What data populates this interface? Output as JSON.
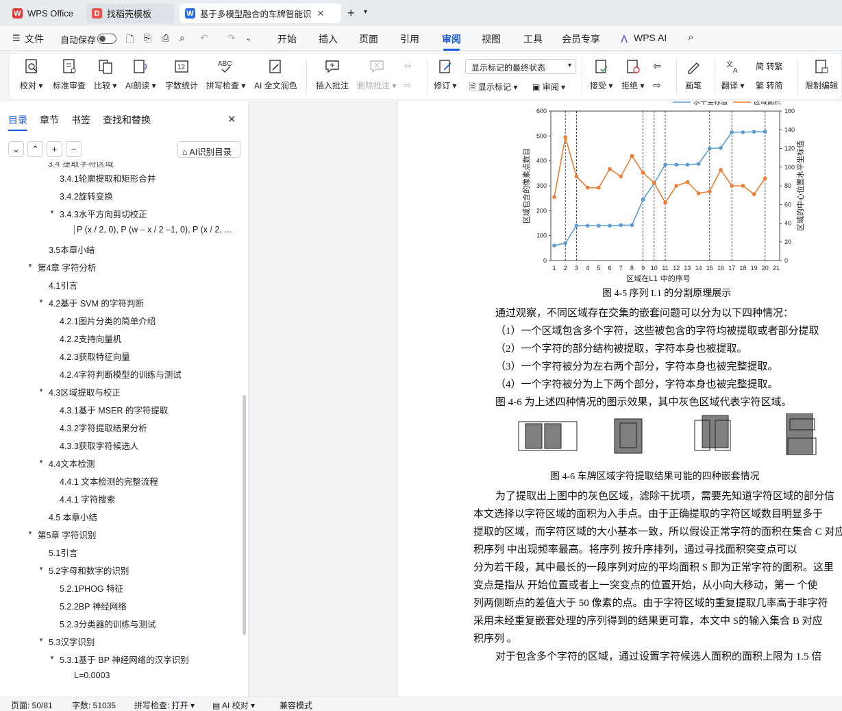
{
  "tabs": {
    "wps_office": "WPS Office",
    "template": "找稻壳模板",
    "document": "基于多模型融合的车牌智能识"
  },
  "menu": {
    "file": "文件",
    "autosave": "自动保存",
    "items": [
      "开始",
      "插入",
      "页面",
      "引用",
      "审阅",
      "视图",
      "工具",
      "会员专享"
    ],
    "ai": "WPS AI"
  },
  "ribbon": {
    "proofread": "校对",
    "standard_review": "标准审查",
    "compare": "比较",
    "ai_read": "AI朗读",
    "word_count": "字数统计",
    "spell_check": "拼写检查",
    "ai_polish": "AI 全文润色",
    "insert_comment": "插入批注",
    "delete_comment": "删除批注",
    "track": "修订",
    "markup_mode": "显示标记的最终状态",
    "show_markup": "显示标记",
    "review": "审阅",
    "accept": "接受",
    "reject": "拒绝",
    "ink": "画笔",
    "translate": "翻译",
    "to_traditional": "转繁",
    "to_simplified": "转简",
    "restrict_edit": "限制编辑"
  },
  "sidebar": {
    "tabs": [
      "目录",
      "章节",
      "书签",
      "查找和替换"
    ],
    "ai_toc": "AI识别目录",
    "toc": [
      {
        "t": "3.4.1轮廓提取和矩形合并",
        "l": 3
      },
      {
        "t": "3.4.2旋转变换",
        "l": 3
      },
      {
        "t": "3.4.3水平方向剪切校正",
        "l": 3,
        "exp": true
      },
      {
        "t": "P (x / 2, 0), P (w – x / 2 –1, 0), P (x / 2, ...",
        "l": 4
      },
      {
        "t": "3.5本章小结",
        "l": 2
      },
      {
        "t": "第4章 字符分析",
        "l": 1,
        "exp": true
      },
      {
        "t": "4.1引言",
        "l": 2
      },
      {
        "t": "4.2基于 SVM 的字符判断",
        "l": 2,
        "exp": true
      },
      {
        "t": "4.2.1图片分类的简单介绍",
        "l": 3
      },
      {
        "t": "4.2.2支持向量机",
        "l": 3
      },
      {
        "t": "4.2.3获取特征向量",
        "l": 3
      },
      {
        "t": "4.2.4字符判断模型的训练与测试",
        "l": 3
      },
      {
        "t": "4.3区域提取与校正",
        "l": 2,
        "exp": true
      },
      {
        "t": "4.3.1基于 MSER 的字符提取",
        "l": 3
      },
      {
        "t": "4.3.2字符提取结果分析",
        "l": 3
      },
      {
        "t": "4.3.3获取字符候选人",
        "l": 3
      },
      {
        "t": "4.4文本检测",
        "l": 2,
        "exp": true
      },
      {
        "t": "4.4.1 文本检测的完整流程",
        "l": 3
      },
      {
        "t": "4.4.1 字符搜索",
        "l": 3
      },
      {
        "t": "4.5 本章小结",
        "l": 2
      },
      {
        "t": "第5章 字符识别",
        "l": 1,
        "exp": true
      },
      {
        "t": "5.1引言",
        "l": 2
      },
      {
        "t": "5.2字母和数字的识别",
        "l": 2,
        "exp": true
      },
      {
        "t": "5.2.1PHOG 特征",
        "l": 3
      },
      {
        "t": "5.2.2BP 神经网络",
        "l": 3
      },
      {
        "t": "5.2.3分类器的训练与测试",
        "l": 3
      },
      {
        "t": "5.3汉字识别",
        "l": 2,
        "exp": true
      },
      {
        "t": "5.3.1基于 BP 神经网络的汉字识别",
        "l": 3,
        "exp": true
      },
      {
        "t": "L=0.0003",
        "l": 4
      }
    ]
  },
  "doc": {
    "fig45_caption": "图 4-5 序列 L1 的分割原理展示",
    "fig46_caption": "图 4-6 车牌区域字符提取结果可能的四种嵌套情况",
    "lines": [
      "通过观察，不同区域存在交集的嵌套问题可以分为以下四种情况：",
      "（1）一个区域包含多个字符，这些被包含的字符均被提取或者部分提取",
      "（2）一个字符的部分结构被提取，字符本身也被提取。",
      "（3）一个字符被分为左右两个部分，字符本身也被完整提取。",
      "（4）一个字符被分为上下两个部分，字符本身也被完整提取。",
      "图 4-6 为上述四种情况的图示效果，其中灰色区域代表字符区域。"
    ],
    "para": [
      "为了提取出上图中的灰色区域，滤除干扰项，需要先知道字符区域的部分信",
      "本文选择以字符区域的面积为入手点。由于正确提取的字符区域数目明显多于",
      "提取的区域，而字符区域的大小基本一致，所以假设正常字符的面积在集合 C 对应",
      "积序列      中出现频率最高。将序列      按升序排列，通过寻找面积突变点可以",
      "分为若干段，其中最长的一段序列对应的平均面积 S 即为正常字符的面积。这里",
      "变点是指从      开始位置或者上一突变点的位置开始，从小向大移动，第一 个使",
      "列两侧断点的差值大于  50 像素的点。由于字符区域的重复提取几率高于非字符",
      "采用未经重复嵌套处理的序列得到的结果更可靠，本文中  S的输入集合  B 对应",
      "积序列      。",
      "对于包含多个字符的区域，通过设置字符候选人面积的面积上限为  1.5 倍"
    ]
  },
  "chart_data": {
    "type": "line",
    "xlabel": "区域在L1 中的序号",
    "ylabel": "区域包含的像素点数目",
    "ylabel_right": "区域的中心位置水平坐标值",
    "x": [
      1,
      2,
      3,
      4,
      5,
      6,
      7,
      8,
      9,
      10,
      11,
      12,
      13,
      14,
      15,
      16,
      17,
      18,
      19,
      20
    ],
    "xlim": [
      1,
      21
    ],
    "ylim": [
      0,
      600
    ],
    "ylim_right": [
      0,
      160
    ],
    "series": [
      {
        "name": "水平坐标值",
        "axis": "left",
        "color": "#5b9bd5",
        "values": [
          60,
          70,
          140,
          140,
          140,
          140,
          142,
          142,
          245,
          310,
          385,
          385,
          385,
          388,
          450,
          452,
          515,
          515,
          517,
          517
        ]
      },
      {
        "name": "区域面积",
        "axis": "right",
        "color": "#ed7d31",
        "values": [
          68,
          132,
          90,
          78,
          78,
          98,
          90,
          112,
          94,
          83,
          62,
          80,
          84,
          72,
          74,
          97,
          80,
          80,
          71,
          88
        ]
      }
    ],
    "dashed_x": [
      2,
      3,
      9,
      10,
      11,
      15,
      17,
      20
    ]
  },
  "status": {
    "page": "页面: 50/81",
    "words": "字数: 51035",
    "spell": "拼写检查: 打开",
    "ai": "AI 校对",
    "compat": "兼容模式"
  }
}
